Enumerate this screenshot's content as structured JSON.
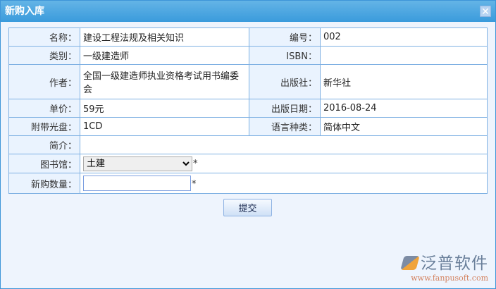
{
  "title": "新购入库",
  "rows": {
    "name_label": "名称：",
    "name": "建设工程法规及相关知识",
    "no_label": "编号：",
    "no": "002",
    "cat_label": "类别：",
    "cat": "一级建造师",
    "isbn_label": "ISBN：",
    "isbn": "",
    "author_label": "作者：",
    "author": "全国一级建造师执业资格考试用书编委会",
    "pub_label": "出版社：",
    "pub": "新华社",
    "price_label": "单价：",
    "price": "59元",
    "date_label": "出版日期：",
    "date": "2016-08-24",
    "cd_label": "附带光盘：",
    "cd": "1CD",
    "lang_label": "语言种类：",
    "lang": "简体中文",
    "intro_label": "简介：",
    "intro": "",
    "lib_label": "图书馆：",
    "lib": "土建",
    "qty_label": "新购数量：",
    "qty": "",
    "required": "*"
  },
  "submit": "提交",
  "logo": {
    "name": "泛普软件",
    "url": "www.fanpusoft.com"
  }
}
